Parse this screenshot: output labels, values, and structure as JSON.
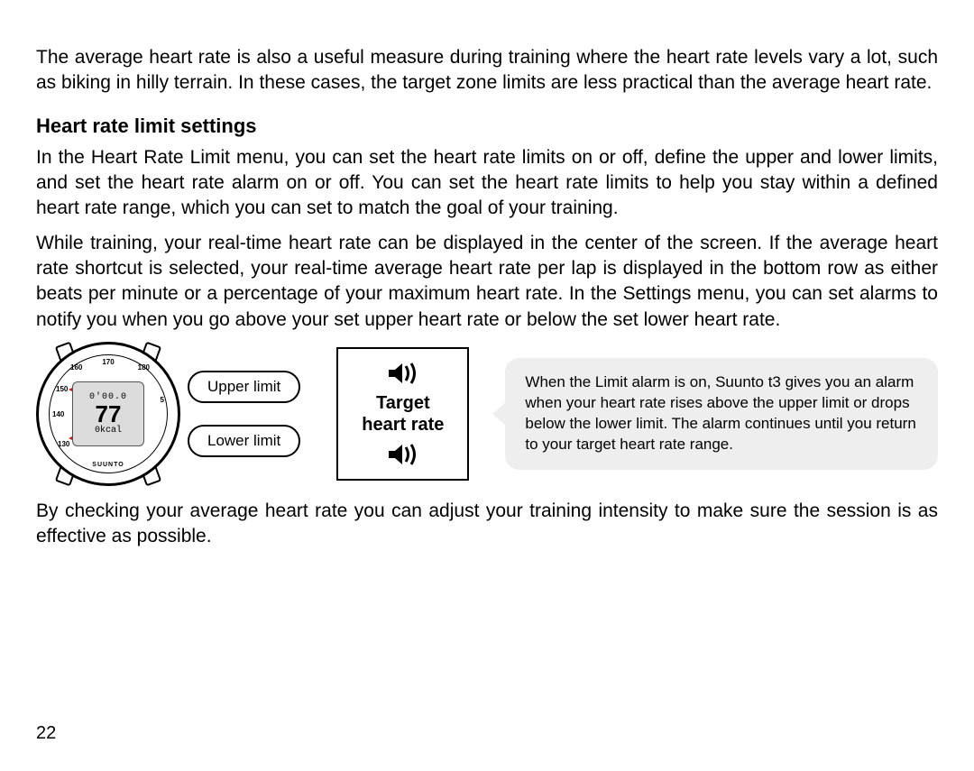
{
  "page_number": "22",
  "intro_paragraph": "The average heart rate is also a useful measure during training where the heart rate levels vary a lot, such as biking in hilly terrain. In these cases, the target zone limits are less practical than the average heart rate.",
  "section_heading": "Heart rate limit settings",
  "paragraph2": "In the Heart Rate Limit menu, you can set the heart rate limits on or off, define the upper and lower limits, and set the heart rate alarm on or off. You can set the heart rate limits to help you stay within a defined heart rate range, which you can set to match the goal of your training.",
  "paragraph3": "While training, your real-time heart rate can be displayed in the center of the screen. If the average heart rate shortcut is selected, your real-time average heart rate per lap is displayed in the bottom row as either beats per minute or a percentage of your maximum heart rate. In the Settings menu, you can set alarms to notify you when you go above your set upper heart rate or below the set lower heart rate.",
  "paragraph4": "By checking your average heart rate you can adjust your training intensity to make sure the session is as effective as possible.",
  "figure": {
    "watch": {
      "top_readout": "0'00.0",
      "main_readout": "77",
      "bottom_readout": "0kcal",
      "brand": "SUUNTO"
    },
    "upper_limit_label": "Upper limit",
    "lower_limit_label": "Lower limit",
    "target_line1": "Target",
    "target_line2": "heart rate",
    "callout_text": "When the Limit alarm is on, Suunto t3 gives you an alarm when your heart rate rises above the upper limit or drops below the lower limit. The alarm continues until you return to your target heart rate range."
  }
}
